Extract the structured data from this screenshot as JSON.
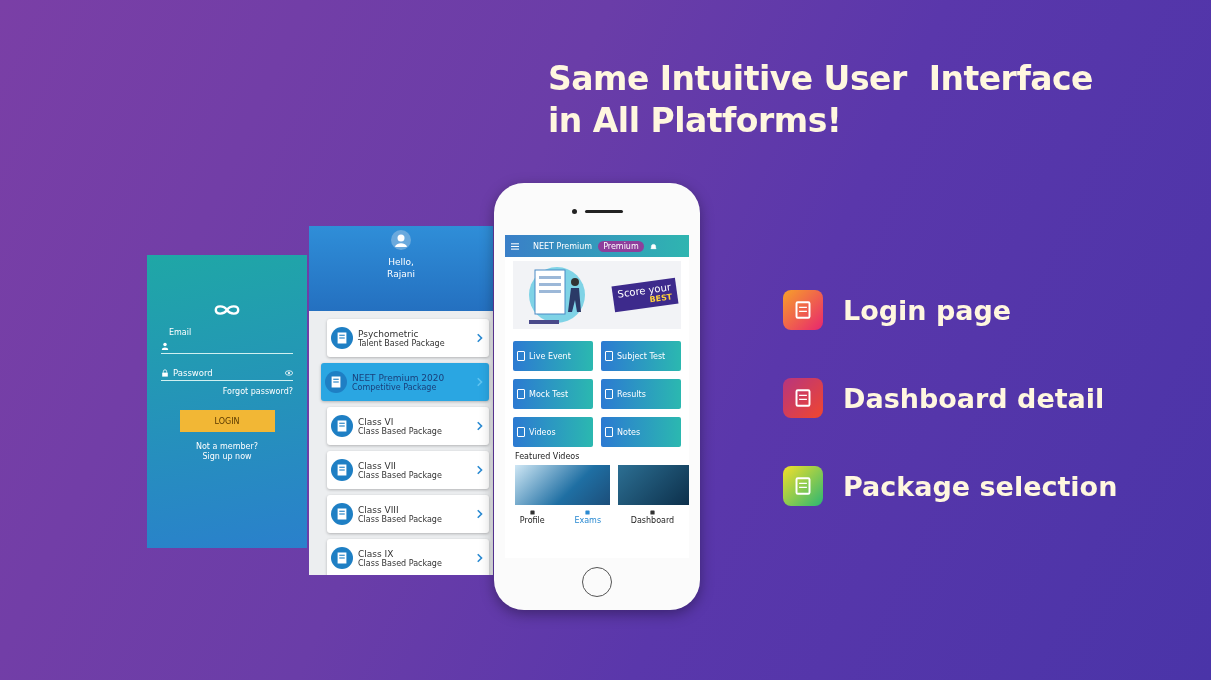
{
  "headline": [
    "Same Intuitive User  Interface",
    "in All Platforms!"
  ],
  "login_screen": {
    "email_label": "Email",
    "password_placeholder": "Password",
    "forgot_link": "Forgot password?",
    "login_button": "LOGIN",
    "signup_prompt": "Not a member?",
    "signup_link": "Sign up now"
  },
  "package_screen": {
    "greeting": "Hello,",
    "name": "Rajani",
    "packages": [
      {
        "title": "Psychometric",
        "subtitle": "Talent Based Package",
        "selected": false
      },
      {
        "title": "NEET Premium 2020",
        "subtitle": "Competitive Package",
        "selected": true
      },
      {
        "title": "Class VI",
        "subtitle": "Class Based Package",
        "selected": false
      },
      {
        "title": "Class VII",
        "subtitle": "Class Based Package",
        "selected": false
      },
      {
        "title": "Class VIII",
        "subtitle": "Class Based Package",
        "selected": false
      },
      {
        "title": "Class IX",
        "subtitle": "Class Based Package",
        "selected": false
      }
    ]
  },
  "dashboard_screen": {
    "title": "NEET Premium",
    "badge": "Premium",
    "banner_text": "Score your",
    "banner_subtext": "BEST",
    "tiles": [
      "Live Event",
      "Subject Test",
      "Mock Test",
      "Results",
      "Videos",
      "Notes"
    ],
    "section_title": "Featured Videos",
    "nav": [
      {
        "label": "Profile",
        "selected": false
      },
      {
        "label": "Exams",
        "selected": true
      },
      {
        "label": "Dashboard",
        "selected": false
      }
    ]
  },
  "features": [
    {
      "kind": "login",
      "label": "Login page"
    },
    {
      "kind": "dashboard",
      "label": "Dashboard detail"
    },
    {
      "kind": "package",
      "label": "Package selection"
    }
  ]
}
